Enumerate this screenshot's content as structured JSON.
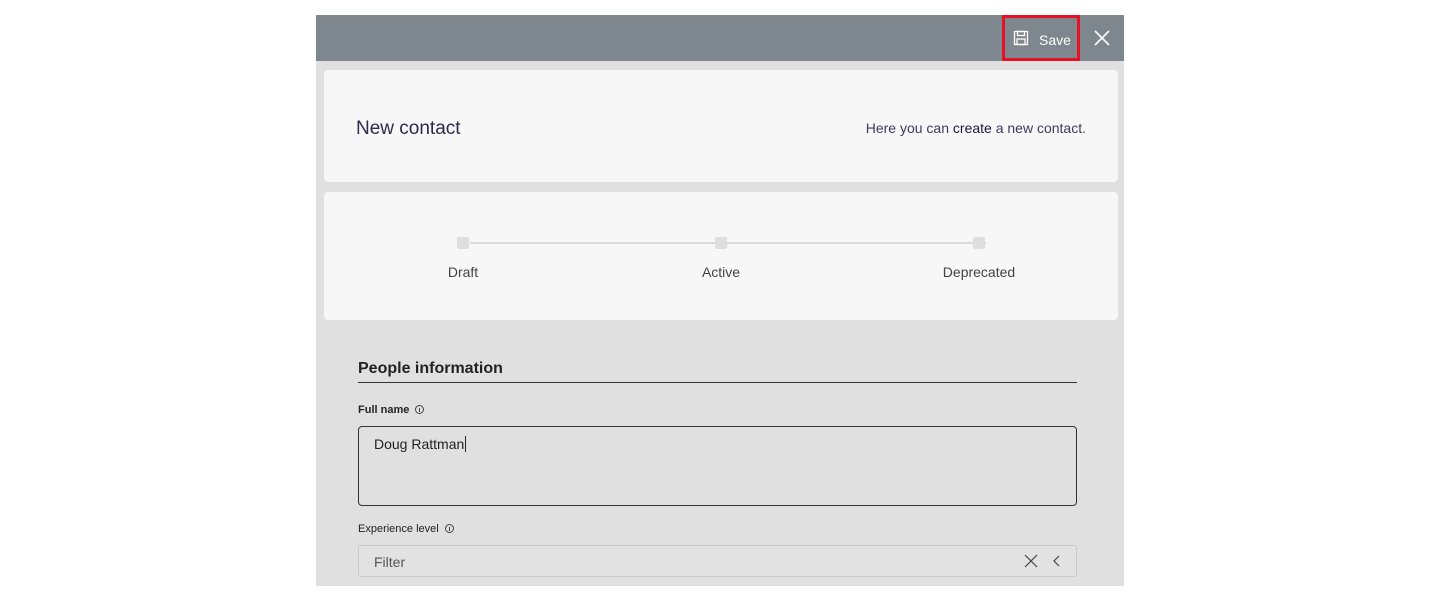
{
  "toolbar": {
    "save_label": "Save",
    "save_icon": "floppy-disk-icon",
    "close_icon": "close-icon"
  },
  "header": {
    "title": "New contact",
    "description_prefix": "Here you can ",
    "description_emphasis": "create",
    "description_suffix": " a new contact."
  },
  "stages": [
    {
      "label": "Draft"
    },
    {
      "label": "Active"
    },
    {
      "label": "Deprecated"
    }
  ],
  "section": {
    "title": "People information"
  },
  "fields": {
    "full_name": {
      "label": "Full name",
      "value": "Doug Rattman"
    },
    "experience_level": {
      "label": "Experience level",
      "placeholder": "Filter"
    }
  },
  "colors": {
    "highlight": "#e81123",
    "topbar": "#7f878e"
  }
}
